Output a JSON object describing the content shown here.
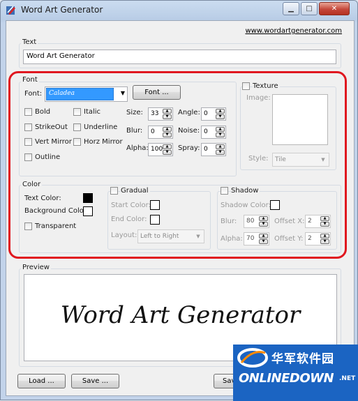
{
  "window": {
    "title": "Word Art Generator"
  },
  "link": "www.wordartgenerator.com",
  "text_group": {
    "label": "Text",
    "value": "Word Art Generator"
  },
  "font_group": {
    "label": "Font",
    "font_label": "Font:",
    "font_value": "Caladea",
    "font_button": "Font ...",
    "checkboxes": {
      "bold": "Bold",
      "italic": "Italic",
      "strikeout": "StrikeOut",
      "underline": "Underline",
      "vert_mirror": "Vert Mirror",
      "horz_mirror": "Horz Mirror",
      "outline": "Outline"
    },
    "size_label": "Size:",
    "size_value": "33",
    "blur_label": "Blur:",
    "blur_value": "0",
    "alpha_label": "Alpha:",
    "alpha_value": "100",
    "angle_label": "Angle:",
    "angle_value": "0",
    "noise_label": "Noise:",
    "noise_value": "0",
    "spray_label": "Spray:",
    "spray_value": "0"
  },
  "texture_group": {
    "label": "Texture",
    "image_label": "Image:",
    "style_label": "Style:",
    "style_value": "Tile"
  },
  "color_group": {
    "label": "Color",
    "text_color_label": "Text Color:",
    "background_color_label": "Background Color",
    "transparent_label": "Transparent",
    "text_color": "#000000",
    "background_color": "#ffffff"
  },
  "gradual_group": {
    "label": "Gradual",
    "start_color_label": "Start Color:",
    "end_color_label": "End Color:",
    "layout_label": "Layout:",
    "layout_value": "Left to Right"
  },
  "shadow_group": {
    "label": "Shadow",
    "shadow_color_label": "Shadow Color:",
    "blur_label": "Blur:",
    "blur_value": "80",
    "alpha_label": "Alpha:",
    "alpha_value": "70",
    "offset_x_label": "Offset X:",
    "offset_x_value": "2",
    "offset_y_label": "Offset Y:",
    "offset_y_value": "2"
  },
  "preview": {
    "label": "Preview",
    "text": "Word Art Generator"
  },
  "buttons": {
    "load": "Load ...",
    "save": "Save ...",
    "save_partial": "Sav"
  },
  "watermark": {
    "cn": "华军软件园",
    "en": "ONLINEDOWN",
    "suffix": ".NET"
  },
  "accent_colors": {
    "highlight_outline": "#e0171f",
    "selection": "#3399ff"
  }
}
